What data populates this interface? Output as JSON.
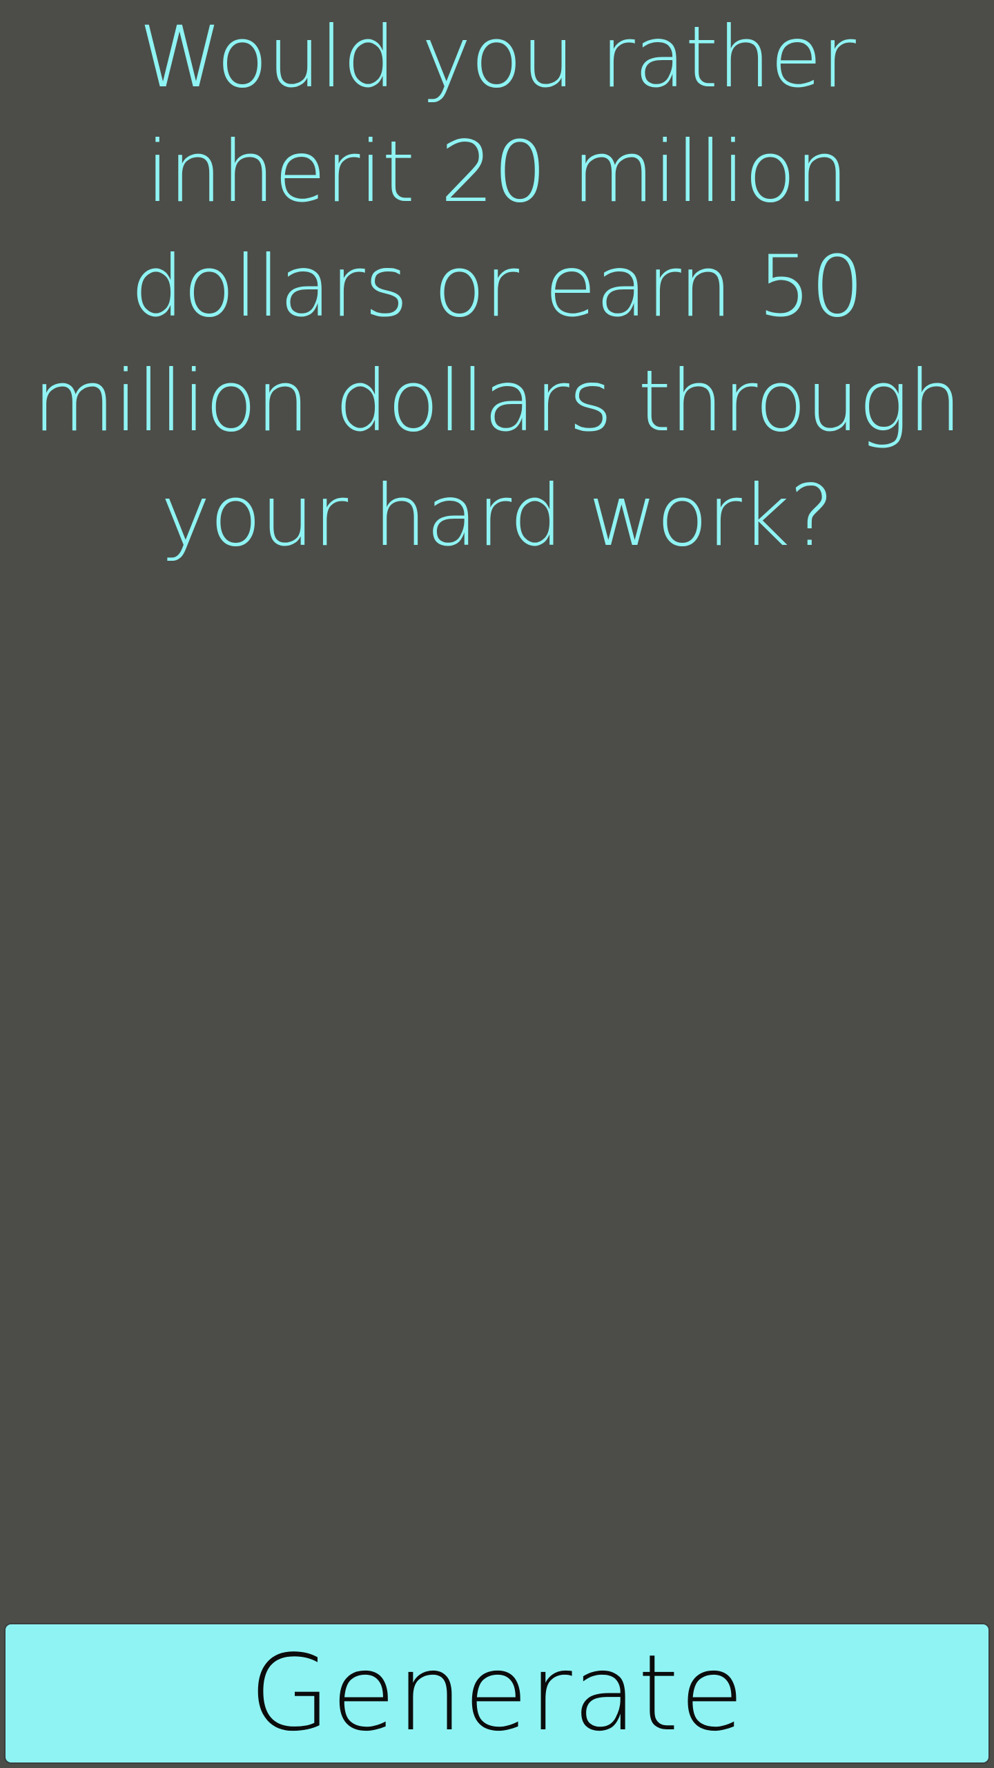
{
  "question": {
    "text": "Would you rather inherit 20 million dollars or earn 50 million dollars through your hard work?"
  },
  "generate_button": {
    "label": "Generate"
  },
  "colors": {
    "background": "#4c4d48",
    "accent": "#8ff3f3",
    "button_text": "#0c0c0c"
  }
}
